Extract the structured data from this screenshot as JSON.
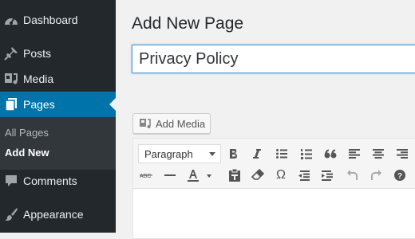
{
  "sidebar": {
    "items": [
      {
        "label": "Dashboard",
        "icon": "dashboard-icon"
      },
      {
        "label": "Posts",
        "icon": "pin-icon"
      },
      {
        "label": "Media",
        "icon": "media-icon"
      },
      {
        "label": "Pages",
        "icon": "pages-icon"
      },
      {
        "label": "Comments",
        "icon": "comment-icon"
      },
      {
        "label": "Appearance",
        "icon": "brush-icon"
      }
    ],
    "active": "Pages",
    "submenu": [
      {
        "label": "All Pages"
      },
      {
        "label": "Add New"
      }
    ],
    "submenu_current": "Add New"
  },
  "main": {
    "title": "Add New Page",
    "title_input_value": "Privacy Policy",
    "add_media_label": "Add Media",
    "editor": {
      "format_select_value": "Paragraph",
      "toolbar_row1": [
        "bold-icon",
        "italic-icon",
        "bullet-list-icon",
        "numbered-list-icon",
        "blockquote-icon",
        "align-left-icon",
        "align-center-icon",
        "align-right-icon"
      ],
      "toolbar_row2": [
        "strikethrough-icon",
        "horizontal-line-icon",
        "text-color-icon",
        "paste-text-icon",
        "clear-formatting-icon",
        "special-character-icon",
        "outdent-icon",
        "indent-icon",
        "undo-icon",
        "redo-icon",
        "help-icon"
      ]
    }
  },
  "colors": {
    "sidebar_bg": "#23282d",
    "active_bg": "#0073aa",
    "page_bg": "#f1f1f1"
  }
}
